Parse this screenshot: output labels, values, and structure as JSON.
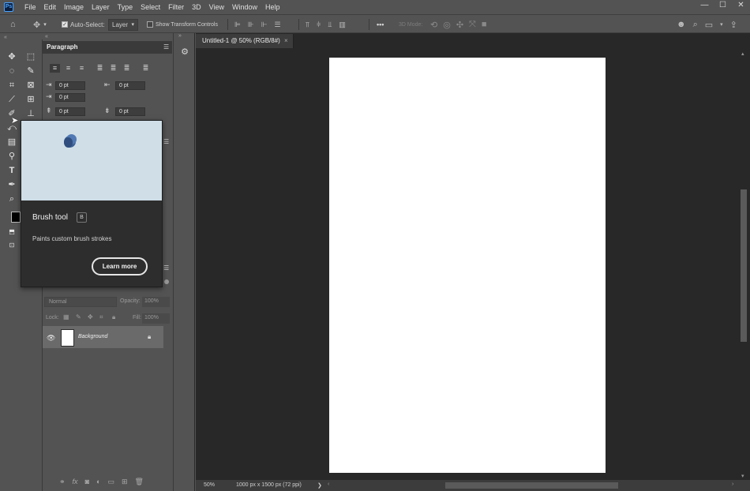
{
  "app": {
    "logo": "Ps"
  },
  "menu": [
    "File",
    "Edit",
    "Image",
    "Layer",
    "Type",
    "Select",
    "Filter",
    "3D",
    "View",
    "Window",
    "Help"
  ],
  "window_controls": {
    "minimize": "—",
    "maximize": "☐",
    "close": "✕"
  },
  "options": {
    "auto_select_label": "Auto-Select:",
    "auto_select_value": "Layer",
    "show_transform_label": "Show Transform Controls",
    "mode_3d_label": "3D Mode:",
    "more": "•••"
  },
  "paragraph": {
    "title": "Paragraph",
    "fields": [
      "0 pt",
      "0 pt",
      "0 pt",
      "0 pt",
      "0 pt"
    ]
  },
  "document": {
    "tab_title": "Untitled-1 @ 50% (RGB/8#)",
    "tab_close": "×",
    "zoom": "50%",
    "info": "1000 px x 1500 px (72 ppi)",
    "status_arrow": "❯"
  },
  "layers": {
    "blend_mode": "Normal",
    "opacity_label": "Opacity:",
    "opacity_value": "100%",
    "lock_label": "Lock:",
    "fill_label": "Fill:",
    "fill_value": "100%",
    "layer_name": "Background"
  },
  "tooltip": {
    "title": "Brush tool",
    "shortcut": "B",
    "description": "Paints custom brush strokes",
    "button": "Learn more"
  }
}
